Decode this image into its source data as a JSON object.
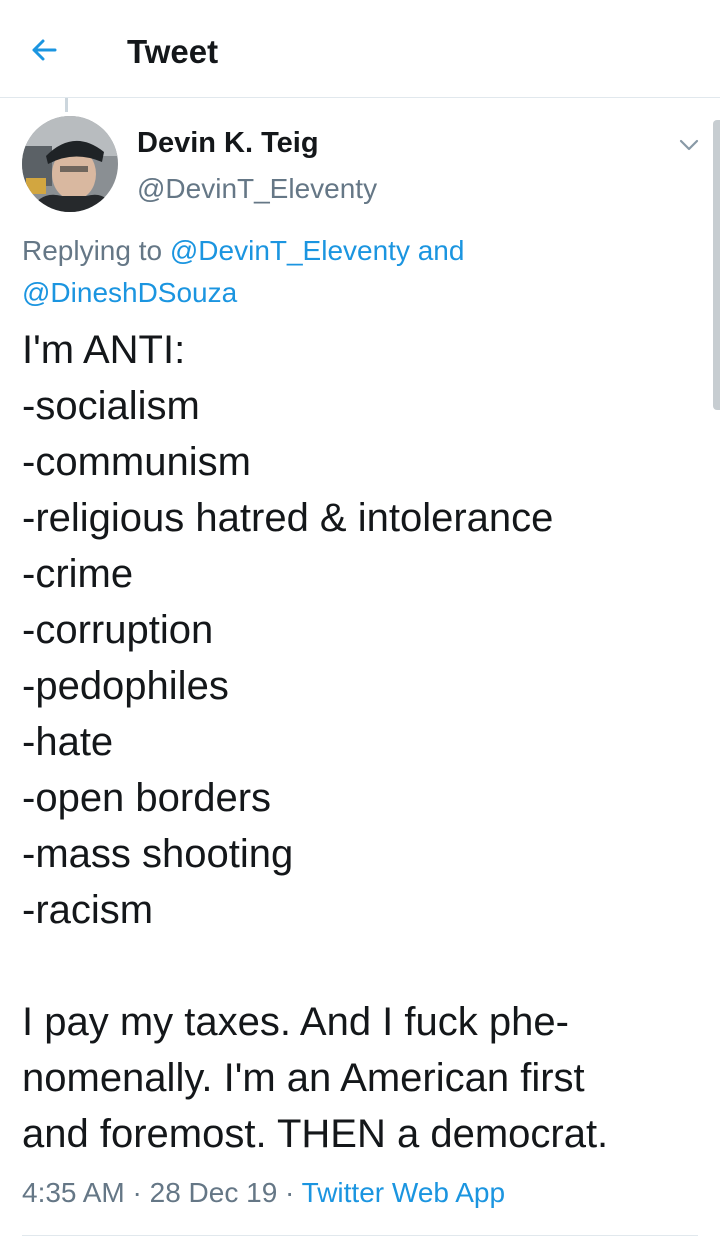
{
  "header": {
    "title": "Tweet",
    "back_icon": "arrow-left-icon",
    "accent_color": "#1b95e0"
  },
  "tweet": {
    "author": {
      "display_name": "Devin K. Teig",
      "handle": "@DevinT_Eleventy",
      "avatar_icon": "avatar-photo"
    },
    "reply_context": {
      "prefix": "Replying to",
      "mentions": [
        "@DevinT_Eleventy",
        "@DineshDSouza"
      ],
      "conjunction": "and"
    },
    "text": "I'm ANTI:\n-socialism\n-communism\n-religious hatred & intolerance\n-crime\n-corruption\n-pedophiles\n-hate\n-open borders\n-mass shooting\n-racism\n\nI pay my taxes. And I fuck phe-\nnomenally. I'm an American first\nand foremost. THEN a democrat.",
    "time": "4:35 AM",
    "separator": "·",
    "date": "28 Dec 19",
    "source": "Twitter Web App",
    "menu_icon": "chevron-down-icon"
  },
  "colors": {
    "text_primary": "#14171a",
    "text_secondary": "#657786",
    "link": "#1b95e0",
    "divider": "#e1e8ed"
  }
}
